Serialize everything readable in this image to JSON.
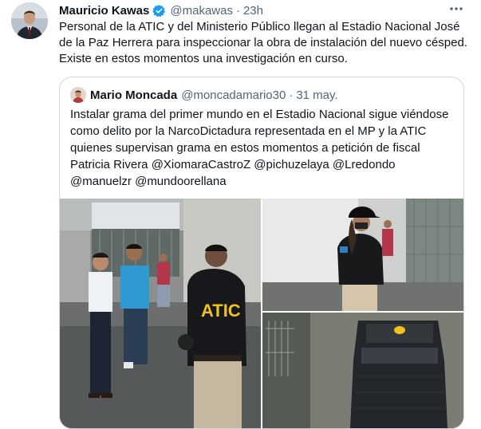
{
  "tweet": {
    "author_name": "Mauricio Kawas",
    "handle": "@makawas",
    "separator": "·",
    "time": "23h",
    "text": "Personal de la ATIC y del Ministerio Público llegan al Estadio Nacional José de la Paz Herrera para inspeccionar la obra de instalación del nuevo césped. Existe en estos momentos una investigación en curso."
  },
  "quoted_tweet": {
    "author_name": "Mario Moncada",
    "handle": "@moncadamario30",
    "separator": "·",
    "date": "31 may.",
    "text": "Instalar grama del primer mundo en el Estadio Nacional sigue viéndose como delito por la NarcoDictadura representada en el MP y la ATIC quienes supervisan grama en estos momentos a petición de fiscal Patricia Rivera @XiomaraCastroZ @pichuzelaya @Lredondo @manuelzr @mundoorellana"
  },
  "media": {
    "photo1_vest_text": "ATIC"
  },
  "colors": {
    "text": "#0f1419",
    "secondary": "#536471",
    "verified": "#1d9bf0",
    "border": "#cfd9de"
  },
  "icons": [
    "verified-badge-icon",
    "more-options-icon"
  ]
}
